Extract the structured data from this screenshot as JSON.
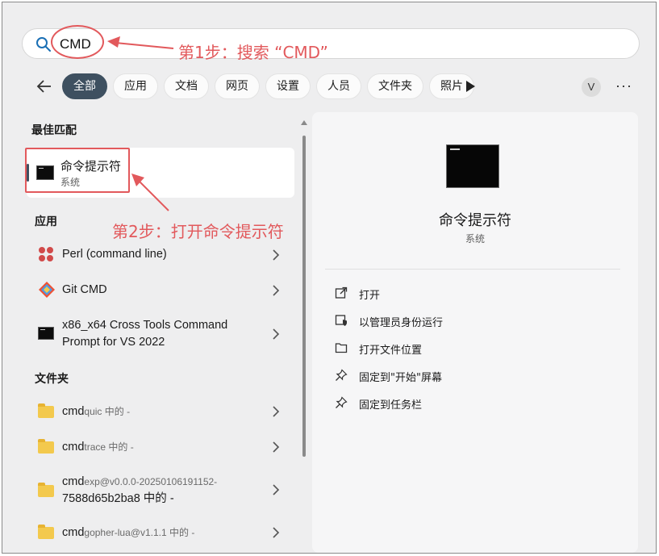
{
  "search": {
    "value": "CMD"
  },
  "annotations": {
    "step1": "第1步：搜索 “CMD”",
    "step2": "第2步：打开命令提示符",
    "color": "#e2595c"
  },
  "filters": {
    "chips": [
      "全部",
      "应用",
      "文档",
      "网页",
      "设置",
      "人员",
      "文件夹",
      "照片"
    ],
    "active": "全部",
    "avatar_letter": "V",
    "more": "···"
  },
  "sections": {
    "best_match": "最佳匹配",
    "apps": "应用",
    "folders": "文件夹"
  },
  "best_match": {
    "title": "命令提示符",
    "subtitle": "系统"
  },
  "apps": [
    {
      "label": "Perl (command line)",
      "icon": "perl-icon"
    },
    {
      "label": "Git CMD",
      "icon": "git-icon"
    },
    {
      "label_line1": "x86_x64 Cross Tools Command",
      "label_line2": "Prompt for VS 2022",
      "icon": "terminal-icon"
    }
  ],
  "folders": [
    {
      "bold": "cmd",
      "rest": "quic 中的 -"
    },
    {
      "bold": "cmd",
      "rest": "trace 中的 -"
    },
    {
      "bold": "cmd",
      "rest": "exp@v0.0.0-20250106191152-",
      "line2": "7588d65b2ba8 中的 -"
    },
    {
      "bold": "cmd",
      "rest": "gopher-lua@v1.1.1 中的 -"
    }
  ],
  "detail": {
    "title": "命令提示符",
    "subtitle": "系统",
    "actions": [
      {
        "label": "打开",
        "icon": "open-external-icon"
      },
      {
        "label": "以管理员身份运行",
        "icon": "shield-run-icon"
      },
      {
        "label": "打开文件位置",
        "icon": "folder-icon"
      },
      {
        "label": "固定到\"开始\"屏幕",
        "icon": "pin-icon"
      },
      {
        "label": "固定到任务栏",
        "icon": "pin-icon"
      }
    ]
  },
  "colors": {
    "accent": "#3e5060",
    "folder": "#f3c94d",
    "annotation": "#e2595c"
  }
}
